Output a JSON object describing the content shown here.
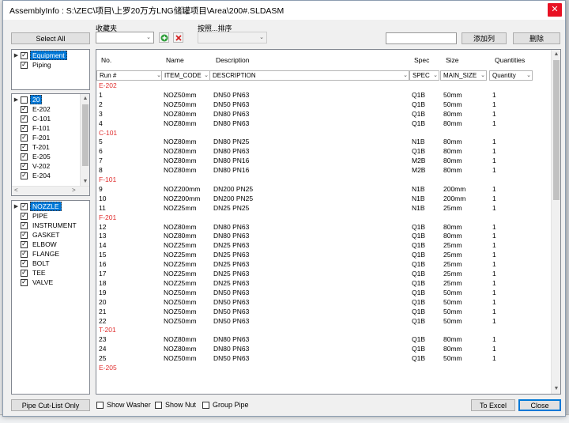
{
  "title": "AssemblyInfo : S:\\ZEC\\项目\\上罗20万方LNG储罐项目\\Area\\200#.SLDASM",
  "toolbar": {
    "select_all": "Select All",
    "favorites_label": "收藏夹",
    "sort_label": "按照...排序",
    "add_column": "添加列",
    "delete": "删除"
  },
  "category_tree": [
    {
      "label": "Equipment",
      "checked": true,
      "selected": true,
      "expander": "▶"
    },
    {
      "label": "Piping",
      "checked": true,
      "selected": false,
      "expander": ""
    }
  ],
  "equipment_tree": [
    {
      "label": "20",
      "checked": false,
      "selected": true,
      "expander": "▶"
    },
    {
      "label": "E-202",
      "checked": true,
      "selected": false
    },
    {
      "label": "C-101",
      "checked": true,
      "selected": false
    },
    {
      "label": "F-101",
      "checked": true,
      "selected": false
    },
    {
      "label": "F-201",
      "checked": true,
      "selected": false
    },
    {
      "label": "T-201",
      "checked": true,
      "selected": false
    },
    {
      "label": "E-205",
      "checked": true,
      "selected": false
    },
    {
      "label": "V-202",
      "checked": true,
      "selected": false
    },
    {
      "label": "E-204",
      "checked": true,
      "selected": false
    }
  ],
  "type_tree": [
    {
      "label": "NOZZLE",
      "checked": true,
      "selected": true,
      "expander": "▶"
    },
    {
      "label": "PIPE",
      "checked": true,
      "selected": false
    },
    {
      "label": "INSTRUMENT",
      "checked": true,
      "selected": false
    },
    {
      "label": "GASKET",
      "checked": true,
      "selected": false
    },
    {
      "label": "ELBOW",
      "checked": true,
      "selected": false
    },
    {
      "label": "FLANGE",
      "checked": true,
      "selected": false
    },
    {
      "label": "BOLT",
      "checked": true,
      "selected": false
    },
    {
      "label": "TEE",
      "checked": true,
      "selected": false
    },
    {
      "label": "VALVE",
      "checked": true,
      "selected": false
    }
  ],
  "grid": {
    "columns": [
      "No.",
      "Name",
      "Description",
      "Spec",
      "Size",
      "Quantities"
    ],
    "filters": [
      "Run #",
      "ITEM_CODE",
      "DESCRIPTION",
      "SPEC",
      "MAIN_SIZE",
      "Quantity"
    ],
    "rows": [
      {
        "group": "E-202"
      },
      {
        "no": "1",
        "name": "NOZ50mm",
        "desc": "DN50 PN63",
        "spec": "Q1B",
        "size": "50mm",
        "qty": "1"
      },
      {
        "no": "2",
        "name": "NOZ50mm",
        "desc": "DN50 PN63",
        "spec": "Q1B",
        "size": "50mm",
        "qty": "1"
      },
      {
        "no": "3",
        "name": "NOZ80mm",
        "desc": "DN80 PN63",
        "spec": "Q1B",
        "size": "80mm",
        "qty": "1"
      },
      {
        "no": "4",
        "name": "NOZ80mm",
        "desc": "DN80 PN63",
        "spec": "Q1B",
        "size": "80mm",
        "qty": "1"
      },
      {
        "group": "C-101"
      },
      {
        "no": "5",
        "name": "NOZ80mm",
        "desc": "DN80 PN25",
        "spec": "N1B",
        "size": "80mm",
        "qty": "1"
      },
      {
        "no": "6",
        "name": "NOZ80mm",
        "desc": "DN80 PN63",
        "spec": "Q1B",
        "size": "80mm",
        "qty": "1"
      },
      {
        "no": "7",
        "name": "NOZ80mm",
        "desc": "DN80 PN16",
        "spec": "M2B",
        "size": "80mm",
        "qty": "1"
      },
      {
        "no": "8",
        "name": "NOZ80mm",
        "desc": "DN80 PN16",
        "spec": "M2B",
        "size": "80mm",
        "qty": "1"
      },
      {
        "group": "F-101"
      },
      {
        "no": "9",
        "name": "NOZ200mm",
        "desc": "DN200 PN25",
        "spec": "N1B",
        "size": "200mm",
        "qty": "1"
      },
      {
        "no": "10",
        "name": "NOZ200mm",
        "desc": "DN200 PN25",
        "spec": "N1B",
        "size": "200mm",
        "qty": "1"
      },
      {
        "no": "11",
        "name": "NOZ25mm",
        "desc": "DN25 PN25",
        "spec": "N1B",
        "size": "25mm",
        "qty": "1"
      },
      {
        "group": "F-201"
      },
      {
        "no": "12",
        "name": "NOZ80mm",
        "desc": "DN80 PN63",
        "spec": "Q1B",
        "size": "80mm",
        "qty": "1"
      },
      {
        "no": "13",
        "name": "NOZ80mm",
        "desc": "DN80 PN63",
        "spec": "Q1B",
        "size": "80mm",
        "qty": "1"
      },
      {
        "no": "14",
        "name": "NOZ25mm",
        "desc": "DN25 PN63",
        "spec": "Q1B",
        "size": "25mm",
        "qty": "1"
      },
      {
        "no": "15",
        "name": "NOZ25mm",
        "desc": "DN25 PN63",
        "spec": "Q1B",
        "size": "25mm",
        "qty": "1"
      },
      {
        "no": "16",
        "name": "NOZ25mm",
        "desc": "DN25 PN63",
        "spec": "Q1B",
        "size": "25mm",
        "qty": "1"
      },
      {
        "no": "17",
        "name": "NOZ25mm",
        "desc": "DN25 PN63",
        "spec": "Q1B",
        "size": "25mm",
        "qty": "1"
      },
      {
        "no": "18",
        "name": "NOZ25mm",
        "desc": "DN25 PN63",
        "spec": "Q1B",
        "size": "25mm",
        "qty": "1"
      },
      {
        "no": "19",
        "name": "NOZ50mm",
        "desc": "DN50 PN63",
        "spec": "Q1B",
        "size": "50mm",
        "qty": "1"
      },
      {
        "no": "20",
        "name": "NOZ50mm",
        "desc": "DN50 PN63",
        "spec": "Q1B",
        "size": "50mm",
        "qty": "1"
      },
      {
        "no": "21",
        "name": "NOZ50mm",
        "desc": "DN50 PN63",
        "spec": "Q1B",
        "size": "50mm",
        "qty": "1"
      },
      {
        "no": "22",
        "name": "NOZ50mm",
        "desc": "DN50 PN63",
        "spec": "Q1B",
        "size": "50mm",
        "qty": "1"
      },
      {
        "group": "T-201"
      },
      {
        "no": "23",
        "name": "NOZ80mm",
        "desc": "DN80 PN63",
        "spec": "Q1B",
        "size": "80mm",
        "qty": "1"
      },
      {
        "no": "24",
        "name": "NOZ80mm",
        "desc": "DN80 PN63",
        "spec": "Q1B",
        "size": "80mm",
        "qty": "1"
      },
      {
        "no": "25",
        "name": "NOZ50mm",
        "desc": "DN50 PN63",
        "spec": "Q1B",
        "size": "50mm",
        "qty": "1"
      },
      {
        "group": "E-205"
      }
    ]
  },
  "footer": {
    "pipe_cut_list": "Pipe Cut-List Only",
    "show_washer": "Show Washer",
    "show_nut": "Show Nut",
    "group_pipe": "Group Pipe",
    "to_excel": "To Excel",
    "close": "Close"
  },
  "icons": {
    "add": "add-circle-icon",
    "remove": "red-x-icon",
    "close": "close-icon"
  },
  "colors": {
    "group_text": "#e03030",
    "selection": "#0078d7",
    "close_button": "#e81123"
  }
}
